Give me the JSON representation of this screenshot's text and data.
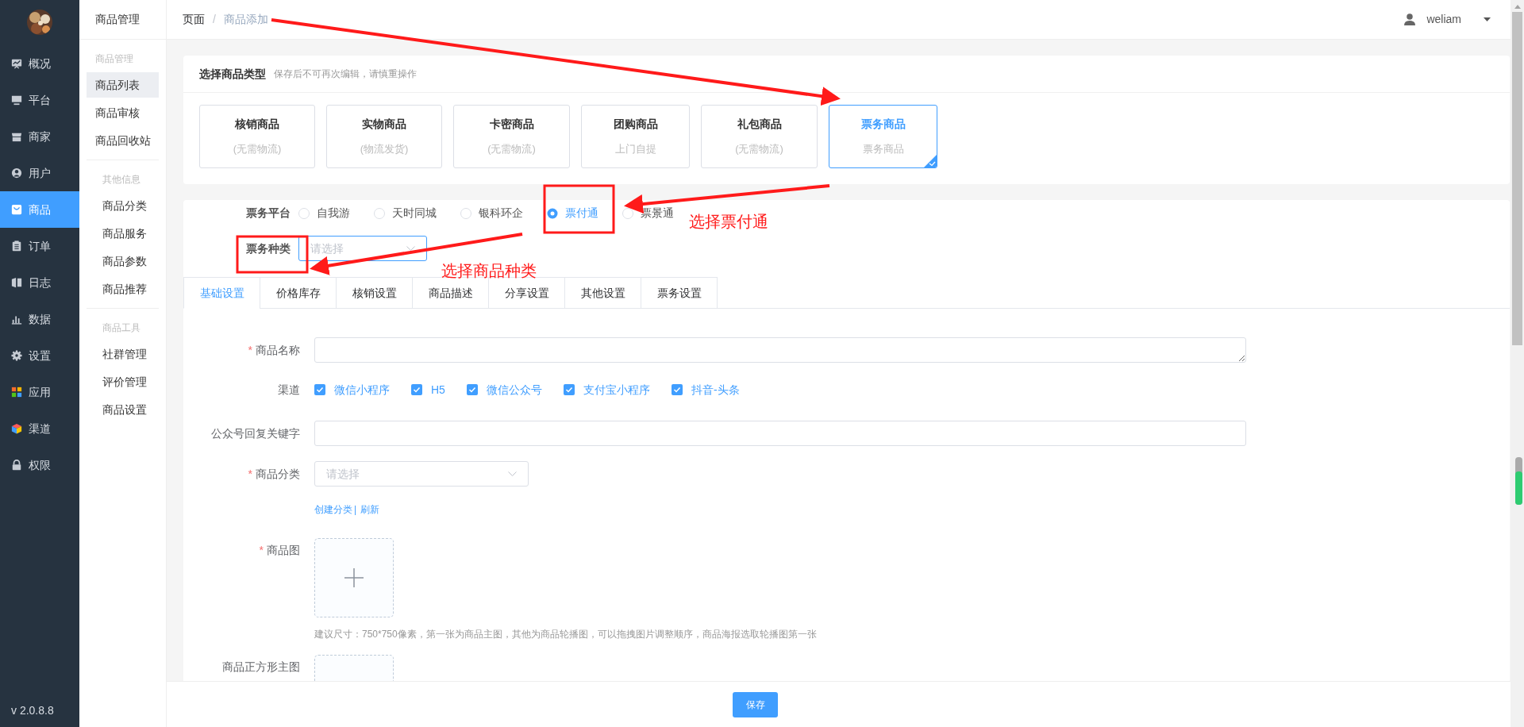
{
  "sidebar": {
    "items": [
      {
        "label": "概况",
        "selected": false
      },
      {
        "label": "平台",
        "selected": false
      },
      {
        "label": "商家",
        "selected": false
      },
      {
        "label": "用户",
        "selected": false
      },
      {
        "label": "商品",
        "selected": true
      },
      {
        "label": "订单",
        "selected": false
      },
      {
        "label": "日志",
        "selected": false
      },
      {
        "label": "数据",
        "selected": false
      },
      {
        "label": "设置",
        "selected": false
      },
      {
        "label": "应用",
        "selected": false
      },
      {
        "label": "渠道",
        "selected": false
      },
      {
        "label": "权限",
        "selected": false
      }
    ],
    "version": "v 2.0.8.8"
  },
  "subnav": {
    "title": "商品管理",
    "groups": [
      {
        "heading": "商品管理",
        "items": [
          {
            "label": "商品列表",
            "selected": true
          },
          {
            "label": "商品审核",
            "selected": false
          },
          {
            "label": "商品回收站",
            "selected": false
          }
        ]
      },
      {
        "heading": "其他信息",
        "items": [
          {
            "label": "商品分类",
            "selected": false
          },
          {
            "label": "商品服务",
            "selected": false
          },
          {
            "label": "商品参数",
            "selected": false
          },
          {
            "label": "商品推荐",
            "selected": false
          }
        ]
      },
      {
        "heading": "商品工具",
        "items": [
          {
            "label": "社群管理",
            "selected": false
          },
          {
            "label": "评价管理",
            "selected": false
          },
          {
            "label": "商品设置",
            "selected": false
          }
        ]
      }
    ]
  },
  "breadcrumb": [
    "页面",
    "商品添加"
  ],
  "breadcrumb_separator": "/",
  "user": {
    "name": "weliam"
  },
  "type_card": {
    "title": "选择商品类型",
    "hint": "保存后不可再次编辑，请慎重操作",
    "types": [
      {
        "name": "核销商品",
        "sub": "(无需物流)",
        "selected": false
      },
      {
        "name": "实物商品",
        "sub": "(物流发货)",
        "selected": false
      },
      {
        "name": "卡密商品",
        "sub": "(无需物流)",
        "selected": false
      },
      {
        "name": "团购商品",
        "sub": "上门自提",
        "selected": false
      },
      {
        "name": "礼包商品",
        "sub": "(无需物流)",
        "selected": false
      },
      {
        "name": "票务商品",
        "sub": "票务商品",
        "selected": true
      }
    ]
  },
  "ticket": {
    "platform_label": "票务平台",
    "platforms": [
      {
        "label": "自我游",
        "selected": false
      },
      {
        "label": "天时同城",
        "selected": false
      },
      {
        "label": "银科环企",
        "selected": false
      },
      {
        "label": "票付通",
        "selected": true
      },
      {
        "label": "票景通",
        "selected": false
      }
    ],
    "category_label": "票务种类",
    "category_placeholder": "请选择"
  },
  "tabs": [
    {
      "label": "基础设置",
      "selected": true
    },
    {
      "label": "价格库存",
      "selected": false
    },
    {
      "label": "核销设置",
      "selected": false
    },
    {
      "label": "商品描述",
      "selected": false
    },
    {
      "label": "分享设置",
      "selected": false
    },
    {
      "label": "其他设置",
      "selected": false
    },
    {
      "label": "票务设置",
      "selected": false
    }
  ],
  "form": {
    "required_mark": "*",
    "fields": [
      {
        "kind": "textarea",
        "label": "商品名称",
        "required": true
      },
      {
        "kind": "checkboxes",
        "label": "渠道",
        "required": false,
        "options": [
          {
            "label": "微信小程序",
            "checked": true
          },
          {
            "label": "H5",
            "checked": true
          },
          {
            "label": "微信公众号",
            "checked": true
          },
          {
            "label": "支付宝小程序",
            "checked": true
          },
          {
            "label": "抖音-头条",
            "checked": true
          }
        ]
      },
      {
        "kind": "text",
        "label": "公众号回复关键字",
        "required": false
      },
      {
        "kind": "select",
        "label": "商品分类",
        "required": true,
        "placeholder": "请选择",
        "links": [
          "创建分类",
          "刷新"
        ],
        "separator": "|"
      },
      {
        "kind": "upload",
        "label": "商品图",
        "required": true,
        "hint": "建议尺寸：750*750像素，第一张为商品主图，其他为商品轮播图，可以拖拽图片调整顺序，商品海报选取轮播图第一张"
      },
      {
        "kind": "upload",
        "label": "商品正方形主图",
        "required": false
      }
    ]
  },
  "save_button": "保存",
  "annotations": [
    "选择票付通",
    "选择商品种类"
  ]
}
